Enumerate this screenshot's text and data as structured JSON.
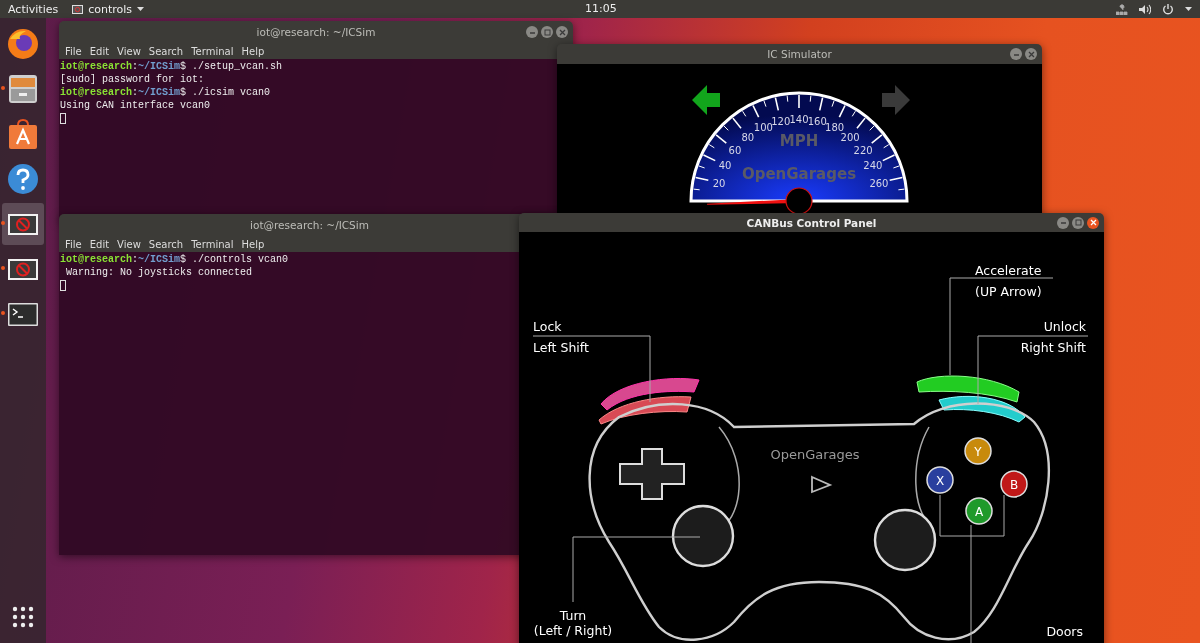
{
  "top_bar": {
    "activities": "Activities",
    "app_menu": "controls",
    "clock": "11:05"
  },
  "dock": {
    "items": [
      {
        "kind": "firefox",
        "running": false,
        "selected": false
      },
      {
        "kind": "files",
        "running": true,
        "selected": false
      },
      {
        "kind": "software",
        "running": false,
        "selected": false
      },
      {
        "kind": "help",
        "running": false,
        "selected": false
      },
      {
        "kind": "icsim",
        "running": true,
        "selected": true
      },
      {
        "kind": "icsim",
        "running": true,
        "selected": false
      },
      {
        "kind": "terminal",
        "running": true,
        "selected": false
      },
      {
        "kind": "apps",
        "running": false,
        "selected": false
      }
    ]
  },
  "windows": [
    {
      "kind": "terminal",
      "title": "iot@research: ~/ICSim",
      "focused": false,
      "controls": [
        {
          "kind": "minimize"
        },
        {
          "kind": "maximize"
        },
        {
          "kind": "close"
        }
      ],
      "menu": [
        "File",
        "Edit",
        "View",
        "Search",
        "Terminal",
        "Help"
      ],
      "lines": [
        {
          "parts": [
            {
              "kind": "user",
              "text": "iot@research"
            },
            {
              "kind": "plain",
              "text": ":"
            },
            {
              "kind": "path",
              "text": "~/ICSim"
            },
            {
              "kind": "plain",
              "text": "$ ./setup_vcan.sh"
            }
          ]
        },
        {
          "parts": [
            {
              "kind": "plain",
              "text": "[sudo] password for iot:"
            }
          ]
        },
        {
          "parts": [
            {
              "kind": "user",
              "text": "iot@research"
            },
            {
              "kind": "plain",
              "text": ":"
            },
            {
              "kind": "path",
              "text": "~/ICSim"
            },
            {
              "kind": "plain",
              "text": "$ ./icsim vcan0"
            }
          ]
        },
        {
          "parts": [
            {
              "kind": "plain",
              "text": "Using CAN interface vcan0"
            }
          ]
        }
      ]
    },
    {
      "kind": "icsim",
      "title": "IC Simulator",
      "focused": false,
      "controls": [
        {
          "kind": "minimize"
        },
        {
          "kind": "close"
        }
      ],
      "turn_signals": [
        {
          "kind": "left",
          "on": true
        },
        {
          "kind": "right",
          "on": false
        }
      ],
      "speedometer": {
        "unit": "MPH",
        "brand": "OpenGarages",
        "scale_labels": [
          "20",
          "40",
          "60",
          "80",
          "100",
          "120",
          "140",
          "160",
          "180",
          "200",
          "220",
          "240",
          "260"
        ]
      }
    },
    {
      "kind": "terminal",
      "title": "iot@research: ~/ICSim",
      "focused": false,
      "menu": [
        "File",
        "Edit",
        "View",
        "Search",
        "Terminal",
        "Help"
      ],
      "lines": [
        {
          "parts": [
            {
              "kind": "user",
              "text": "iot@research"
            },
            {
              "kind": "plain",
              "text": ":"
            },
            {
              "kind": "path",
              "text": "~/ICSim"
            },
            {
              "kind": "plain",
              "text": "$ ./controls vcan0"
            }
          ]
        },
        {
          "parts": [
            {
              "kind": "plain",
              "text": " Warning: No joysticks connected"
            }
          ]
        }
      ]
    },
    {
      "kind": "controller",
      "title": "CANBus Control Panel",
      "focused": true,
      "controls": [
        {
          "kind": "minimize"
        },
        {
          "kind": "maximize"
        },
        {
          "kind": "close"
        }
      ],
      "logo": "OpenGarages",
      "face_buttons": [
        {
          "label": "Y",
          "color": "#c88a0c"
        },
        {
          "label": "X",
          "color": "#2a3f9e"
        },
        {
          "label": "B",
          "color": "#c01818"
        },
        {
          "label": "A",
          "color": "#1f9a2a"
        }
      ],
      "callouts": [
        {
          "title": "Accelerate",
          "subtitle": "(UP Arrow)"
        },
        {
          "title": "Lock",
          "subtitle": "Left Shift"
        },
        {
          "title": "Unlock",
          "subtitle": "Right Shift"
        },
        {
          "title": "Turn",
          "subtitle": "(Left / Right)"
        },
        {
          "title": "Doors"
        }
      ]
    }
  ]
}
